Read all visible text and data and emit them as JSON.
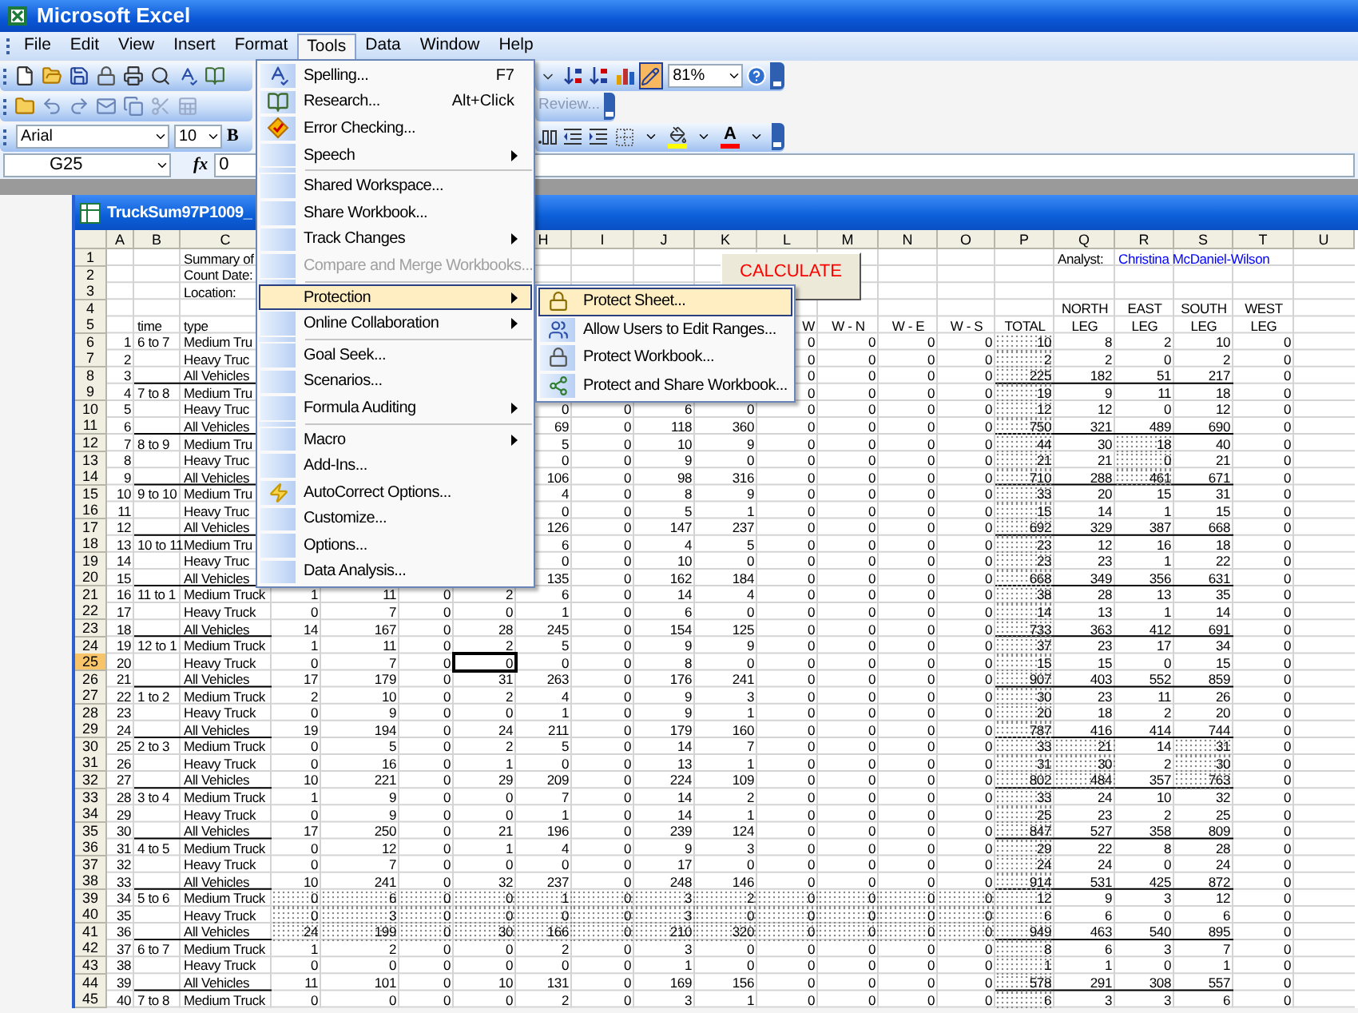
{
  "window": {
    "title": "Microsoft Excel"
  },
  "menu_bar": [
    {
      "label": "File",
      "selected": false
    },
    {
      "label": "Edit",
      "selected": false
    },
    {
      "label": "View",
      "selected": false
    },
    {
      "label": "Insert",
      "selected": false
    },
    {
      "label": "Format",
      "selected": false
    },
    {
      "label": "Tools",
      "selected": true
    },
    {
      "label": "Data",
      "selected": false
    },
    {
      "label": "Window",
      "selected": false
    },
    {
      "label": "Help",
      "selected": false
    }
  ],
  "toolbar": {
    "zoom": "81%",
    "review": "Review...",
    "font": "Arial",
    "font_size": "10",
    "bold": "B",
    "font_color": "A"
  },
  "formula_bar": {
    "name_box": "G25",
    "fx": "fx",
    "value": "0"
  },
  "tools_menu": {
    "items": [
      {
        "kind": "item",
        "label": "Spelling...",
        "shortcut": "F7",
        "submenu": false,
        "disabled": false,
        "selected": false
      },
      {
        "kind": "item",
        "label": "Research...",
        "shortcut": "Alt+Click",
        "submenu": false,
        "disabled": false,
        "selected": false
      },
      {
        "kind": "item",
        "label": "Error Checking...",
        "submenu": false,
        "disabled": false,
        "selected": false
      },
      {
        "kind": "item",
        "label": "Speech",
        "submenu": true,
        "disabled": false,
        "selected": false
      },
      {
        "kind": "separator"
      },
      {
        "kind": "item",
        "label": "Shared Workspace...",
        "submenu": false,
        "disabled": false,
        "selected": false
      },
      {
        "kind": "item",
        "label": "Share Workbook...",
        "submenu": false,
        "disabled": false,
        "selected": false
      },
      {
        "kind": "item",
        "label": "Track Changes",
        "submenu": true,
        "disabled": false,
        "selected": false
      },
      {
        "kind": "item",
        "label": "Compare and Merge Workbooks...",
        "submenu": false,
        "disabled": true,
        "selected": false
      },
      {
        "kind": "separator"
      },
      {
        "kind": "item",
        "label": "Protection",
        "submenu": true,
        "disabled": false,
        "selected": true
      },
      {
        "kind": "item",
        "label": "Online Collaboration",
        "submenu": true,
        "disabled": false,
        "selected": false
      },
      {
        "kind": "separator"
      },
      {
        "kind": "item",
        "label": "Goal Seek...",
        "submenu": false,
        "disabled": false,
        "selected": false
      },
      {
        "kind": "item",
        "label": "Scenarios...",
        "submenu": false,
        "disabled": false,
        "selected": false
      },
      {
        "kind": "item",
        "label": "Formula Auditing",
        "submenu": true,
        "disabled": false,
        "selected": false
      },
      {
        "kind": "separator"
      },
      {
        "kind": "item",
        "label": "Macro",
        "submenu": true,
        "disabled": false,
        "selected": false
      },
      {
        "kind": "item",
        "label": "Add-Ins...",
        "submenu": false,
        "disabled": false,
        "selected": false
      },
      {
        "kind": "item",
        "label": "AutoCorrect Options...",
        "submenu": false,
        "disabled": false,
        "selected": false
      },
      {
        "kind": "item",
        "label": "Customize...",
        "submenu": false,
        "disabled": false,
        "selected": false
      },
      {
        "kind": "item",
        "label": "Options...",
        "submenu": false,
        "disabled": false,
        "selected": false
      },
      {
        "kind": "item",
        "label": "Data Analysis...",
        "submenu": false,
        "disabled": false,
        "selected": false
      }
    ]
  },
  "protection_submenu": {
    "items": [
      {
        "label": "Protect Sheet...",
        "selected": true
      },
      {
        "label": "Allow Users to Edit Ranges...",
        "selected": false
      },
      {
        "label": "Protect Workbook...",
        "selected": false
      },
      {
        "label": "Protect and Share Workbook...",
        "selected": false
      }
    ]
  },
  "workbook": {
    "title": "TruckSum97P1009_",
    "button": {
      "label": "CALCULATE"
    },
    "columns": [
      "A",
      "B",
      "C",
      null,
      null,
      null,
      null,
      "H",
      "I",
      "J",
      "K",
      "L",
      "M",
      "N",
      "O",
      "P",
      "Q",
      "R",
      "S",
      "T",
      "U"
    ],
    "rows": [
      {
        "label": "1",
        "selected": false,
        "cells": [
          null,
          null,
          "Summary of",
          null,
          null,
          null,
          null,
          null,
          null,
          null,
          null,
          null,
          null,
          null,
          null,
          null,
          "Analyst:",
          {
            "text": "Christina McDaniel-Wilson",
            "color": "#0000ff"
          },
          null,
          null,
          null
        ]
      },
      {
        "label": "2",
        "selected": false,
        "cells": [
          null,
          null,
          "Count Date:",
          null,
          null,
          null,
          null,
          null,
          null,
          null,
          null,
          null,
          null,
          null,
          null,
          null,
          null,
          null,
          null,
          null,
          null
        ]
      },
      {
        "label": "3",
        "selected": false,
        "cells": [
          null,
          null,
          "Location:",
          null,
          null,
          null,
          null,
          null,
          null,
          null,
          null,
          null,
          null,
          null,
          null,
          null,
          null,
          null,
          null,
          null,
          null
        ]
      },
      {
        "label": "4",
        "selected": false,
        "cells": [
          null,
          null,
          null,
          null,
          null,
          null,
          null,
          null,
          null,
          null,
          null,
          null,
          null,
          null,
          null,
          null,
          "NORTH",
          "EAST",
          "SOUTH",
          "WEST",
          null
        ]
      },
      {
        "label": "5",
        "selected": false,
        "cells": [
          null,
          "time",
          "type",
          null,
          null,
          null,
          null,
          null,
          null,
          null,
          null,
          "W",
          "W - N",
          "W - E",
          "W - S",
          "TOTAL",
          "LEG",
          "LEG",
          "LEG",
          "LEG",
          null
        ]
      },
      {
        "label": "6",
        "selected": false,
        "cells": [
          "1",
          "6 to 7",
          "Medium Tru",
          null,
          null,
          null,
          null,
          null,
          null,
          null,
          null,
          "0",
          "0",
          "0",
          "0",
          {
            "text": "10",
            "shaded": true
          },
          "8",
          "2",
          "10",
          "0",
          null
        ]
      },
      {
        "label": "7",
        "selected": false,
        "cells": [
          "2",
          null,
          "Heavy Truc",
          null,
          null,
          null,
          null,
          null,
          null,
          null,
          null,
          "0",
          "0",
          "0",
          "0",
          {
            "text": "2",
            "shaded": true
          },
          "2",
          "0",
          "2",
          "0",
          null
        ]
      },
      {
        "label": "8",
        "selected": false,
        "cells": [
          "3",
          null,
          "All Vehicles",
          null,
          null,
          null,
          null,
          null,
          null,
          null,
          null,
          "0",
          "0",
          "0",
          "0",
          {
            "text": "225",
            "shaded": true
          },
          "182",
          "51",
          "217",
          "0",
          null
        ]
      },
      {
        "label": "9",
        "selected": false,
        "cells": [
          "4",
          "7 to 8",
          "Medium Tru",
          null,
          null,
          null,
          null,
          null,
          null,
          null,
          null,
          "0",
          "0",
          "0",
          "0",
          {
            "text": "19",
            "shaded": true
          },
          "9",
          "11",
          "18",
          "0",
          null
        ]
      },
      {
        "label": "10",
        "selected": false,
        "cells": [
          "5",
          null,
          "Heavy Truc",
          null,
          null,
          null,
          null,
          "0",
          "0",
          "6",
          "0",
          "0",
          "0",
          "0",
          "0",
          {
            "text": "12",
            "shaded": true
          },
          "12",
          "0",
          "12",
          "0",
          null
        ]
      },
      {
        "label": "11",
        "selected": false,
        "cells": [
          "6",
          null,
          "All Vehicles",
          null,
          null,
          null,
          null,
          "69",
          "0",
          "118",
          "360",
          "0",
          "0",
          "0",
          "0",
          {
            "text": "750",
            "shaded": true
          },
          "321",
          "489",
          "690",
          "0",
          null
        ]
      },
      {
        "label": "12",
        "selected": false,
        "cells": [
          "7",
          "8 to 9",
          "Medium Tru",
          null,
          null,
          null,
          null,
          "5",
          "0",
          "10",
          "9",
          "0",
          "0",
          "0",
          "0",
          {
            "text": "44",
            "shaded": true
          },
          "30",
          {
            "text": "18",
            "shaded": true
          },
          "40",
          "0",
          null
        ]
      },
      {
        "label": "13",
        "selected": false,
        "cells": [
          "8",
          null,
          "Heavy Truc",
          null,
          null,
          null,
          null,
          "0",
          "0",
          "9",
          "0",
          "0",
          "0",
          "0",
          "0",
          {
            "text": "21",
            "shaded": true
          },
          "21",
          {
            "text": "0",
            "shaded": true
          },
          "21",
          "0",
          null
        ]
      },
      {
        "label": "14",
        "selected": false,
        "cells": [
          "9",
          null,
          "All Vehicles",
          null,
          null,
          null,
          null,
          "106",
          "0",
          "98",
          "316",
          "0",
          "0",
          "0",
          "0",
          {
            "text": "710",
            "shaded": true
          },
          "288",
          {
            "text": "461",
            "shaded": true
          },
          "671",
          "0",
          null
        ]
      },
      {
        "label": "15",
        "selected": false,
        "cells": [
          "10",
          "9 to 10",
          "Medium Tru",
          null,
          null,
          null,
          null,
          "4",
          "0",
          "8",
          "9",
          "0",
          "0",
          "0",
          "0",
          {
            "text": "33",
            "shaded": true
          },
          "20",
          "15",
          "31",
          "0",
          null
        ]
      },
      {
        "label": "16",
        "selected": false,
        "cells": [
          "11",
          null,
          "Heavy Truc",
          null,
          null,
          null,
          null,
          "0",
          "0",
          "5",
          "1",
          "0",
          "0",
          "0",
          "0",
          {
            "text": "15",
            "shaded": true
          },
          "14",
          "1",
          "15",
          "0",
          null
        ]
      },
      {
        "label": "17",
        "selected": false,
        "cells": [
          "12",
          null,
          "All Vehicles",
          null,
          null,
          null,
          null,
          "126",
          "0",
          "147",
          "237",
          "0",
          "0",
          "0",
          "0",
          {
            "text": "692",
            "shaded": true
          },
          "329",
          "387",
          "668",
          "0",
          null
        ]
      },
      {
        "label": "18",
        "selected": false,
        "cells": [
          "13",
          "10 to 11",
          "Medium Tru",
          null,
          null,
          null,
          null,
          "6",
          "0",
          "4",
          "5",
          "0",
          "0",
          "0",
          "0",
          {
            "text": "23",
            "shaded": true
          },
          "12",
          "16",
          "18",
          "0",
          null
        ]
      },
      {
        "label": "19",
        "selected": false,
        "cells": [
          "14",
          null,
          "Heavy Truc",
          null,
          null,
          null,
          null,
          "0",
          "0",
          "10",
          "0",
          "0",
          "0",
          "0",
          "0",
          {
            "text": "23",
            "shaded": true
          },
          "23",
          "1",
          "22",
          "0",
          null
        ]
      },
      {
        "label": "20",
        "selected": false,
        "cells": [
          "15",
          null,
          "All Vehicles",
          null,
          null,
          null,
          null,
          "135",
          "0",
          "162",
          "184",
          "0",
          "0",
          "0",
          "0",
          {
            "text": "668",
            "shaded": true
          },
          "349",
          "356",
          "631",
          "0",
          null
        ]
      },
      {
        "label": "21",
        "selected": false,
        "cells": [
          "16",
          "11 to 1",
          "Medium Truck",
          "1",
          "11",
          "0",
          "2",
          "6",
          "0",
          "14",
          "4",
          "0",
          "0",
          "0",
          "0",
          {
            "text": "38",
            "shaded": true
          },
          "28",
          "13",
          "35",
          "0",
          null
        ]
      },
      {
        "label": "22",
        "selected": false,
        "cells": [
          "17",
          null,
          "Heavy Truck",
          "0",
          "7",
          "0",
          "0",
          "1",
          "0",
          "6",
          "0",
          "0",
          "0",
          "0",
          "0",
          {
            "text": "14",
            "shaded": true
          },
          "13",
          "1",
          "14",
          "0",
          null
        ]
      },
      {
        "label": "23",
        "selected": false,
        "cells": [
          "18",
          null,
          "All Vehicles",
          "14",
          "167",
          "0",
          "28",
          "245",
          "0",
          "154",
          "125",
          "0",
          "0",
          "0",
          "0",
          {
            "text": "733",
            "shaded": true
          },
          "363",
          "412",
          "691",
          "0",
          null
        ]
      },
      {
        "label": "24",
        "selected": false,
        "cells": [
          "19",
          "12 to 1",
          "Medium Truck",
          "1",
          "11",
          "0",
          "2",
          "5",
          "0",
          "9",
          "9",
          "0",
          "0",
          "0",
          "0",
          {
            "text": "37",
            "shaded": true
          },
          "23",
          "17",
          "34",
          "0",
          null
        ]
      },
      {
        "label": "25",
        "selected": true,
        "cells": [
          "20",
          null,
          "Heavy Truck",
          "0",
          "7",
          "0",
          {
            "text": "0",
            "selected": true
          },
          "0",
          "0",
          "8",
          "0",
          "0",
          "0",
          "0",
          "0",
          {
            "text": "15",
            "shaded": true
          },
          "15",
          "0",
          "15",
          "0",
          null
        ]
      },
      {
        "label": "26",
        "selected": false,
        "cells": [
          "21",
          null,
          "All Vehicles",
          "17",
          "179",
          "0",
          "31",
          "263",
          "0",
          "176",
          "241",
          "0",
          "0",
          "0",
          "0",
          {
            "text": "907",
            "shaded": true
          },
          "403",
          "552",
          "859",
          "0",
          null
        ]
      },
      {
        "label": "27",
        "selected": false,
        "cells": [
          "22",
          "1 to 2",
          "Medium Truck",
          "2",
          "10",
          "0",
          "2",
          "4",
          "0",
          "9",
          "3",
          "0",
          "0",
          "0",
          "0",
          {
            "text": "30",
            "shaded": true
          },
          "23",
          "11",
          "26",
          "0",
          null
        ]
      },
      {
        "label": "28",
        "selected": false,
        "cells": [
          "23",
          null,
          "Heavy Truck",
          "0",
          "9",
          "0",
          "0",
          "1",
          "0",
          "9",
          "1",
          "0",
          "0",
          "0",
          "0",
          {
            "text": "20",
            "shaded": true
          },
          "18",
          "2",
          "20",
          "0",
          null
        ]
      },
      {
        "label": "29",
        "selected": false,
        "cells": [
          "24",
          null,
          "All Vehicles",
          "19",
          "194",
          "0",
          "24",
          "211",
          "0",
          "179",
          "160",
          "0",
          "0",
          "0",
          "0",
          {
            "text": "787",
            "shaded": true
          },
          "416",
          "414",
          "744",
          "0",
          null
        ]
      },
      {
        "label": "30",
        "selected": false,
        "cells": [
          "25",
          "2 to 3",
          "Medium Truck",
          "0",
          "5",
          "0",
          "2",
          "5",
          "0",
          "14",
          "7",
          "0",
          "0",
          "0",
          "0",
          {
            "text": "33",
            "shaded": true
          },
          {
            "text": "21",
            "shaded": true
          },
          "14",
          {
            "text": "31",
            "shaded": true
          },
          "0",
          null
        ]
      },
      {
        "label": "31",
        "selected": false,
        "cells": [
          "26",
          null,
          "Heavy Truck",
          "0",
          "16",
          "0",
          "1",
          "0",
          "0",
          "13",
          "1",
          "0",
          "0",
          "0",
          "0",
          {
            "text": "31",
            "shaded": true
          },
          {
            "text": "30",
            "shaded": true
          },
          "2",
          {
            "text": "30",
            "shaded": true
          },
          "0",
          null
        ]
      },
      {
        "label": "32",
        "selected": false,
        "cells": [
          "27",
          null,
          "All Vehicles",
          "10",
          "221",
          "0",
          "29",
          "209",
          "0",
          "224",
          "109",
          "0",
          "0",
          "0",
          "0",
          {
            "text": "802",
            "shaded": true
          },
          {
            "text": "484",
            "shaded": true
          },
          "357",
          {
            "text": "763",
            "shaded": true
          },
          "0",
          null
        ]
      },
      {
        "label": "33",
        "selected": false,
        "cells": [
          "28",
          "3 to 4",
          "Medium Truck",
          "1",
          "9",
          "0",
          "0",
          "7",
          "0",
          "14",
          "2",
          "0",
          "0",
          "0",
          "0",
          {
            "text": "33",
            "shaded": true
          },
          "24",
          "10",
          "32",
          "0",
          null
        ]
      },
      {
        "label": "34",
        "selected": false,
        "cells": [
          "29",
          null,
          "Heavy Truck",
          "0",
          "9",
          "0",
          "0",
          "1",
          "0",
          "14",
          "1",
          "0",
          "0",
          "0",
          "0",
          {
            "text": "25",
            "shaded": true
          },
          "23",
          "2",
          "25",
          "0",
          null
        ]
      },
      {
        "label": "35",
        "selected": false,
        "cells": [
          "30",
          null,
          "All Vehicles",
          "17",
          "250",
          "0",
          "21",
          "196",
          "0",
          "239",
          "124",
          "0",
          "0",
          "0",
          "0",
          {
            "text": "847",
            "shaded": true
          },
          "527",
          "358",
          "809",
          "0",
          null
        ]
      },
      {
        "label": "36",
        "selected": false,
        "cells": [
          "31",
          "4 to 5",
          "Medium Truck",
          "0",
          "12",
          "0",
          "1",
          "4",
          "0",
          "9",
          "3",
          "0",
          "0",
          "0",
          "0",
          {
            "text": "29",
            "shaded": true
          },
          "22",
          "8",
          "28",
          "0",
          null
        ]
      },
      {
        "label": "37",
        "selected": false,
        "cells": [
          "32",
          null,
          "Heavy Truck",
          "0",
          "7",
          "0",
          "0",
          "0",
          "0",
          "17",
          "0",
          "0",
          "0",
          "0",
          "0",
          {
            "text": "24",
            "shaded": true
          },
          "24",
          "0",
          "24",
          "0",
          null
        ]
      },
      {
        "label": "38",
        "selected": false,
        "cells": [
          "33",
          null,
          "All Vehicles",
          "10",
          "241",
          "0",
          "32",
          "237",
          "0",
          "248",
          "146",
          "0",
          "0",
          "0",
          "0",
          {
            "text": "914",
            "shaded": true
          },
          "531",
          "425",
          "872",
          "0",
          null
        ]
      },
      {
        "label": "39",
        "selected": false,
        "cells": [
          "34",
          "5 to 6",
          "Medium Truck",
          {
            "text": "0",
            "shaded": true
          },
          {
            "text": "6",
            "shaded": true
          },
          {
            "text": "0",
            "shaded": true
          },
          {
            "text": "0",
            "shaded": true
          },
          {
            "text": "1",
            "shaded": true
          },
          {
            "text": "0",
            "shaded": true
          },
          {
            "text": "3",
            "shaded": true
          },
          {
            "text": "2",
            "shaded": true
          },
          {
            "text": "0",
            "shaded": true
          },
          {
            "text": "0",
            "shaded": true
          },
          {
            "text": "0",
            "shaded": true
          },
          {
            "text": "0",
            "shaded": true
          },
          {
            "text": "12",
            "shaded": true
          },
          "9",
          "3",
          "12",
          "0",
          null
        ]
      },
      {
        "label": "40",
        "selected": false,
        "cells": [
          "35",
          null,
          "Heavy Truck",
          {
            "text": "0",
            "shaded": true
          },
          {
            "text": "3",
            "shaded": true
          },
          {
            "text": "0",
            "shaded": true
          },
          {
            "text": "0",
            "shaded": true
          },
          {
            "text": "0",
            "shaded": true
          },
          {
            "text": "0",
            "shaded": true
          },
          {
            "text": "3",
            "shaded": true
          },
          {
            "text": "0",
            "shaded": true
          },
          {
            "text": "0",
            "shaded": true
          },
          {
            "text": "0",
            "shaded": true
          },
          {
            "text": "0",
            "shaded": true
          },
          {
            "text": "0",
            "shaded": true
          },
          {
            "text": "6",
            "shaded": true
          },
          "6",
          "0",
          "6",
          "0",
          null
        ]
      },
      {
        "label": "41",
        "selected": false,
        "cells": [
          "36",
          null,
          "All Vehicles",
          {
            "text": "24",
            "shaded": true
          },
          {
            "text": "199",
            "shaded": true
          },
          {
            "text": "0",
            "shaded": true
          },
          {
            "text": "30",
            "shaded": true
          },
          {
            "text": "166",
            "shaded": true
          },
          {
            "text": "0",
            "shaded": true
          },
          {
            "text": "210",
            "shaded": true
          },
          {
            "text": "320",
            "shaded": true
          },
          {
            "text": "0",
            "shaded": true
          },
          {
            "text": "0",
            "shaded": true
          },
          {
            "text": "0",
            "shaded": true
          },
          {
            "text": "0",
            "shaded": true
          },
          {
            "text": "949",
            "shaded": true
          },
          "463",
          "540",
          "895",
          "0",
          null
        ]
      },
      {
        "label": "42",
        "selected": false,
        "cells": [
          "37",
          "6 to 7",
          "Medium Truck",
          "1",
          "2",
          "0",
          "0",
          "2",
          "0",
          "3",
          "0",
          "0",
          "0",
          "0",
          "0",
          {
            "text": "8",
            "shaded": true
          },
          "6",
          "3",
          "7",
          "0",
          null
        ]
      },
      {
        "label": "43",
        "selected": false,
        "cells": [
          "38",
          null,
          "Heavy Truck",
          "0",
          "0",
          "0",
          "0",
          "0",
          "0",
          "1",
          "0",
          "0",
          "0",
          "0",
          "0",
          {
            "text": "1",
            "shaded": true
          },
          "1",
          "0",
          "1",
          "0",
          null
        ]
      },
      {
        "label": "44",
        "selected": false,
        "cells": [
          "39",
          null,
          "All Vehicles",
          "11",
          "101",
          "0",
          "10",
          "131",
          "0",
          "169",
          "156",
          "0",
          "0",
          "0",
          "0",
          {
            "text": "578",
            "shaded": true
          },
          "291",
          "308",
          "557",
          "0",
          null
        ]
      },
      {
        "label": "45",
        "selected": false,
        "cells": [
          "40",
          "7 to 8",
          "Medium Truck",
          "0",
          "0",
          "0",
          "0",
          "2",
          "0",
          "3",
          "1",
          "0",
          "0",
          "0",
          "0",
          {
            "text": "6",
            "shaded": true
          },
          "3",
          "3",
          "6",
          "0",
          null
        ]
      }
    ]
  }
}
